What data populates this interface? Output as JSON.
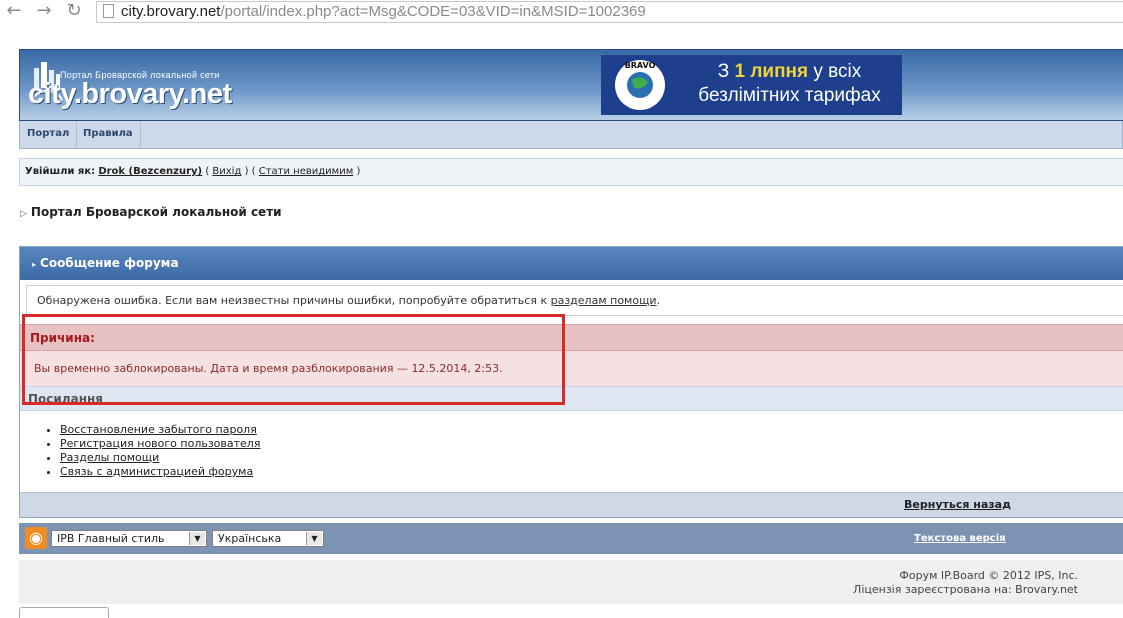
{
  "browser": {
    "url_domain": "city.brovary.net",
    "url_path": "/portal/index.php?act=Msg&CODE=03&VID=in&MSID=1002369",
    "back_icon": "arrow-left-icon",
    "forward_icon": "arrow-right-icon",
    "reload_icon": "reload-icon",
    "page_icon": "page-icon"
  },
  "header": {
    "logo_subtitle": "Портал Броварской локальной сети",
    "logo_title": "city.brovary.net",
    "banner_logo_text": "BRAVO",
    "banner_line1_a": "З ",
    "banner_line1_b": "1 липня",
    "banner_line1_c": " у всіх",
    "banner_line2": "безлімітних тарифах"
  },
  "nav": {
    "tabs": [
      "Портал",
      "Правила"
    ]
  },
  "login": {
    "prefix": "Увійшли як:",
    "username": "Drok (Bezcenzury)",
    "sep1": " ( ",
    "logout": "Вихід",
    "sep2": " ) ( ",
    "invisible": "Стати невидимим",
    "sep3": " )"
  },
  "portal": {
    "title": "Портал Броварской локальной сети"
  },
  "forum": {
    "header": "Сообщение форума",
    "info_text": "Обнаружена ошибка. Если вам неизвестны причины ошибки, попробуйте обратиться к ",
    "info_link": "разделам помощи",
    "info_end": ".",
    "reason_label": "Причина:",
    "reason_text": "Вы временно заблокированы. Дата и время разблокирования — 12.5.2014, 2:53.",
    "links_title": "Посилання",
    "links": [
      "Восстановление забытого пароля",
      "Регистрация нового пользователя",
      "Разделы помощи",
      "Связь с администрацией форума"
    ],
    "back_link": "Вернуться назад"
  },
  "footer": {
    "rss_icon": "rss-icon",
    "skin_select": "IPB Главный стиль",
    "lang_select": "Українська",
    "text_version": "Текстова версія",
    "copyright": "Форум IP.Board © 2012  IPS, Inc.",
    "license": "Ліцензія зареєстрована на: Brovary.net"
  },
  "colors": {
    "header_blue": "#3d6aa5",
    "error_red": "#a4191f",
    "highlight_red": "#d82a2a"
  }
}
